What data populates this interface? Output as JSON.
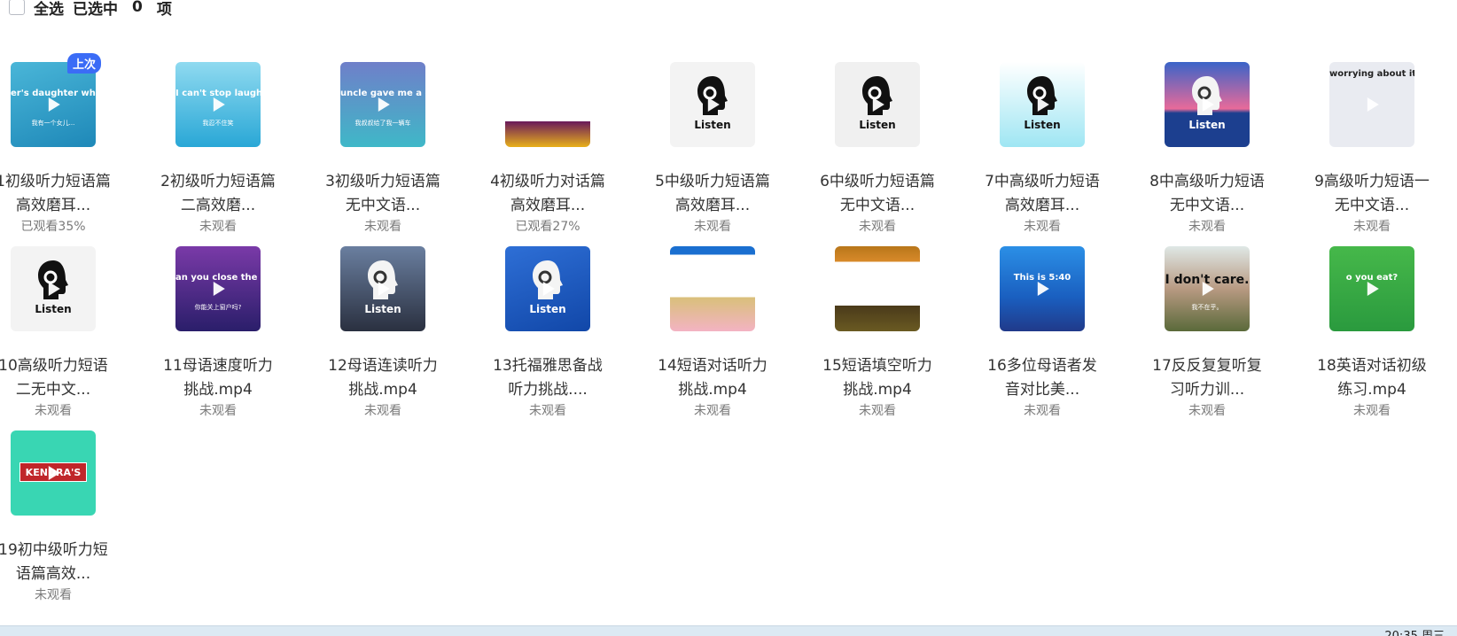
{
  "selection": {
    "select_all_label": "全选",
    "selected_prefix": "已选中",
    "selected_count": "0",
    "selected_suffix": "项"
  },
  "items": [
    {
      "title": "1初级听力短语篇高效磨耳...",
      "status": "已观看35%",
      "badge": "上次",
      "thumb_text": "er's daughter who",
      "thumb_sub": "我有一个女儿...",
      "bg": "linear-gradient(160deg,#4ab6d8,#1e88b8)",
      "kind": "photo"
    },
    {
      "title": "2初级听力短语篇二高效磨...",
      "status": "未观看",
      "thumb_text": "I can't stop laughing.",
      "thumb_sub": "我忍不住笑",
      "bg": "linear-gradient(180deg,#8fdaf0,#29a7d6)",
      "kind": "photo"
    },
    {
      "title": "3初级听力短语篇无中文语...",
      "status": "未观看",
      "thumb_text": "uncle gave me a car",
      "thumb_sub": "我叔叔给了我一辆车",
      "bg": "linear-gradient(180deg,#6f7fc9,#3fb8c8)",
      "kind": "photo"
    },
    {
      "title": "4初级听力对话篇高效磨耳...",
      "status": "已观看27%",
      "thumb_text": "",
      "thumb_sub": "",
      "bg": "linear-gradient(180deg,#ffffff 0%,#ffffff 70%,#6a1a5a 70%,#e8b01a 100%)",
      "kind": "stripe"
    },
    {
      "title": "5中级听力短语篇高效磨耳...",
      "status": "未观看",
      "listen": "Listen",
      "bg": "#f3f3f3",
      "head": "#111",
      "lbl": "#111",
      "kind": "listen"
    },
    {
      "title": "6中级听力短语篇无中文语...",
      "status": "未观看",
      "listen": "Listen",
      "bg": "#f0f0f0",
      "head": "#111",
      "lbl": "#111",
      "kind": "listen"
    },
    {
      "title": "7中高级听力短语高效磨耳...",
      "status": "未观看",
      "listen": "Listen",
      "bg": "linear-gradient(180deg,#ffffff,#9fe6f3)",
      "head": "#111",
      "lbl": "#111",
      "kind": "listen"
    },
    {
      "title": "8中高级听力短语无中文语...",
      "status": "未观看",
      "listen": "Listen",
      "bg": "linear-gradient(180deg,#3a64c8,#e86a9a 55%,#1c3f8f 60%)",
      "head": "#f4f4f4",
      "lbl": "#ffffff",
      "kind": "listen"
    },
    {
      "title": "9高级听力短语一无中文语...",
      "status": "未观看",
      "thumb_text": "worrying about it and tak",
      "thumb_sub": "",
      "bg": "#e9ebf1",
      "kind": "textcard"
    },
    {
      "title": "10高级听力短语二无中文...",
      "status": "未观看",
      "listen": "Listen",
      "bg": "#f3f3f3",
      "head": "#111",
      "lbl": "#111",
      "kind": "listen"
    },
    {
      "title": "11母语速度听力挑战.mp4",
      "status": "未观看",
      "thumb_text": "an you close the window?",
      "thumb_sub": "你能关上窗户吗?",
      "bg": "linear-gradient(180deg,#7a3aa8,#2a1e6a)",
      "kind": "photo"
    },
    {
      "title": "12母语连读听力挑战.mp4",
      "status": "未观看",
      "listen": "Listen",
      "bg": "linear-gradient(180deg,#6a7fa0,#2a3040)",
      "head": "#f4f4f4",
      "lbl": "#ffffff",
      "kind": "listen"
    },
    {
      "title": "13托福雅思备战听力挑战....",
      "status": "未观看",
      "listen": "Listen",
      "bg": "linear-gradient(160deg,#2e6fd6,#1147a8)",
      "head": "#f4f4f4",
      "lbl": "#ffffff",
      "kind": "listen"
    },
    {
      "title": "14短语对话听力挑战.mp4",
      "status": "未观看",
      "thumb_text": "",
      "thumb_sub": "",
      "bg": "linear-gradient(180deg,#1a6fd0 0%,#1a6fd0 10%,#ffffff 10%,#ffffff 60%,#d9c07a 60%,#f3b3c3 100%)",
      "kind": "stripe"
    },
    {
      "title": "15短语填空听力挑战.mp4",
      "status": "未观看",
      "thumb_text": "",
      "thumb_sub": "",
      "bg": "linear-gradient(180deg,#b8761a 0%,#d88a2a 18%,#ffffff 18%,#ffffff 70%,#4a3a1a 70%,#6a5a22 100%)",
      "kind": "stripe"
    },
    {
      "title": "16多位母语者发音对比美...",
      "status": "未观看",
      "thumb_text": "This is 5:40",
      "thumb_sub": "",
      "bg": "linear-gradient(180deg,#2b8fe6,#1a5fc0 60%,#203a8a)",
      "kind": "photo"
    },
    {
      "title": "17反反复复听复习听力训...",
      "status": "未观看",
      "thumb_text": "I don't care.",
      "thumb_sub": "我不在乎。",
      "bg": "linear-gradient(180deg,#dfe8e6,#b89a82 50%,#5a6a3a)",
      "kind": "dark"
    },
    {
      "title": "18英语对话初级练习.mp4",
      "status": "未观看",
      "thumb_text": "o you eat?",
      "thumb_sub": "",
      "bg": "linear-gradient(180deg,#46b84a,#2a9a3e)",
      "kind": "photo"
    },
    {
      "title": "19初中级听力短语篇高效...",
      "status": "未观看",
      "thumb_text": "KENDRA'S",
      "thumb_sub": "",
      "bg": "#39d6b3",
      "kind": "kendra"
    }
  ],
  "taskbar": {
    "clock": "20:35 周三"
  }
}
